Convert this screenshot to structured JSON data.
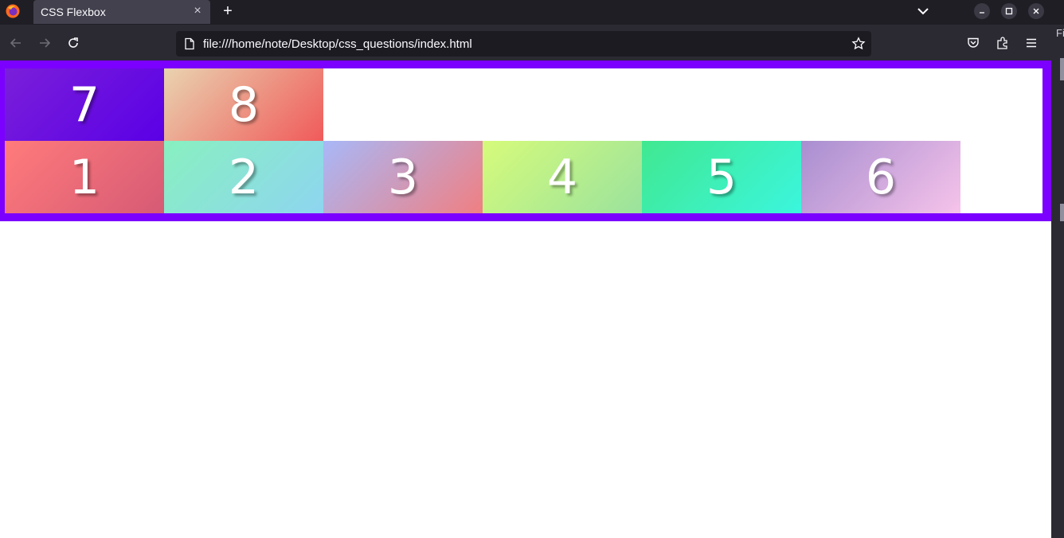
{
  "browser": {
    "tab": {
      "title": "CSS Flexbox",
      "close_glyph": "×"
    },
    "new_tab_glyph": "+",
    "url": "file:///home/note/Desktop/css_questions/index.html",
    "sidebar_label": "Fi"
  },
  "page": {
    "row1": [
      {
        "label": "7",
        "gradient": [
          "#7a1fd9",
          "#5a00e6"
        ]
      },
      {
        "label": "8",
        "gradient": [
          "#e9d3b0",
          "#f05a5a"
        ]
      }
    ],
    "row2": [
      {
        "label": "1",
        "gradient": [
          "#ff7b7b",
          "#d65a75"
        ]
      },
      {
        "label": "2",
        "gradient": [
          "#88f0c0",
          "#8ed5f0"
        ]
      },
      {
        "label": "3",
        "gradient": [
          "#a8b8f8",
          "#f07f82"
        ]
      },
      {
        "label": "4",
        "gradient": [
          "#d6fb7a",
          "#9ae29e"
        ]
      },
      {
        "label": "5",
        "gradient": [
          "#40e890",
          "#3bf6de"
        ]
      },
      {
        "label": "6",
        "gradient": [
          "#a88ed0",
          "#f6c3ea"
        ]
      }
    ],
    "container_border_color": "#7b00ff"
  }
}
